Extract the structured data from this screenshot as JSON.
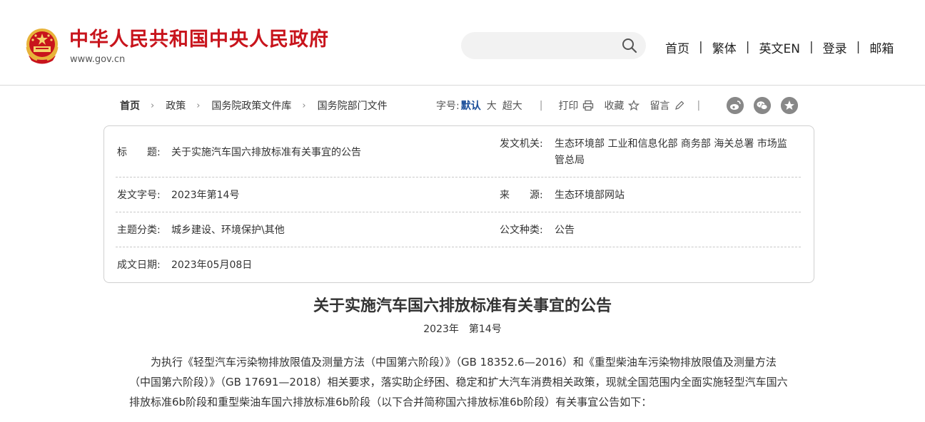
{
  "header": {
    "site_name": "中华人民共和国中央人民政府",
    "site_url": "www.gov.cn",
    "search_placeholder": "",
    "nav": [
      "首页",
      "繁体",
      "英文EN",
      "登录",
      "邮箱"
    ]
  },
  "breadcrumb": [
    "首页",
    "政策",
    "国务院政策文件库",
    "国务院部门文件"
  ],
  "tools": {
    "font_size_label": "字号:",
    "font_options": [
      "默认",
      "大",
      "超大"
    ],
    "print": "打印",
    "favorite": "收藏",
    "comment": "留言"
  },
  "meta": {
    "title_label": "标　　题:",
    "title_value": "关于实施汽车国六排放标准有关事宜的公告",
    "issuer_label": "发文机关:",
    "issuer_value_line1": "生态环境部 工业和信息化部 商务部 海关总署 市场监",
    "issuer_value_line2": "管总局",
    "docno_label": "发文字号:",
    "docno_value": "2023年第14号",
    "source_label": "来　　源:",
    "source_value": "生态环境部网站",
    "topic_label": "主题分类:",
    "topic_value": "城乡建设、环境保护\\其他",
    "type_label": "公文种类:",
    "type_value": "公告",
    "date_label": "成文日期:",
    "date_value": "2023年05月08日"
  },
  "article": {
    "title": "关于实施汽车国六排放标准有关事宜的公告",
    "number": "2023年　第14号",
    "paragraph": "为执行《轻型汽车污染物排放限值及测量方法（中国第六阶段）》（GB 18352.6—2016）和《重型柴油车污染物排放限值及测量方法（中国第六阶段）》（GB 17691—2018）相关要求，落实助企纾困、稳定和扩大汽车消费相关政策，现就全国范围内全面实施轻型汽车国六排放标准6b阶段和重型柴油车国六排放标准6b阶段（以下合并简称国六排放标准6b阶段）有关事宜公告如下："
  },
  "colors": {
    "brand_red": "#c8141c",
    "active_blue": "#1a4d99"
  },
  "icons": [
    "national-emblem-icon",
    "search-icon",
    "print-icon",
    "star-icon",
    "pencil-icon",
    "weibo-icon",
    "wechat-icon",
    "favorite-circle-icon"
  ]
}
